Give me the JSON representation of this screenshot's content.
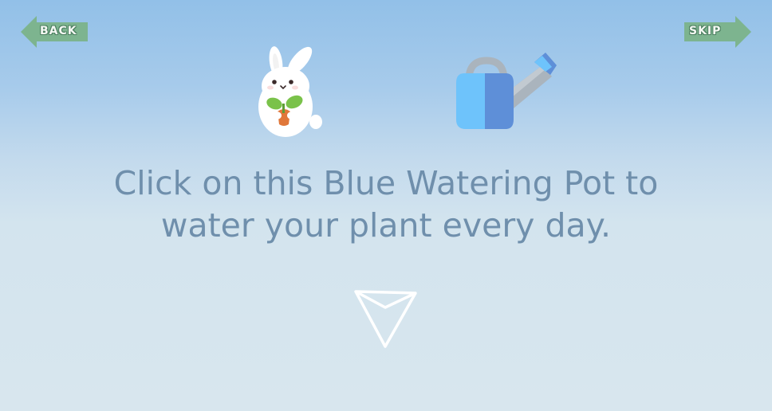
{
  "nav": {
    "back_label": "BACK",
    "skip_label": "SKIP",
    "button_color": "#7db48f"
  },
  "instruction": {
    "line1": "Click on this Blue Watering Pot to",
    "line2": "water your plant every day."
  },
  "icons": {
    "mascot": "bunny-holding-sprout",
    "watering_pot": "blue-watering-pot",
    "pointer": "down-arrow-outline"
  },
  "colors": {
    "text": "#6f8fac",
    "watering_pot_light": "#6ec3fb",
    "watering_pot_dark": "#5e8fd8",
    "sprout": "#7ac24a"
  }
}
